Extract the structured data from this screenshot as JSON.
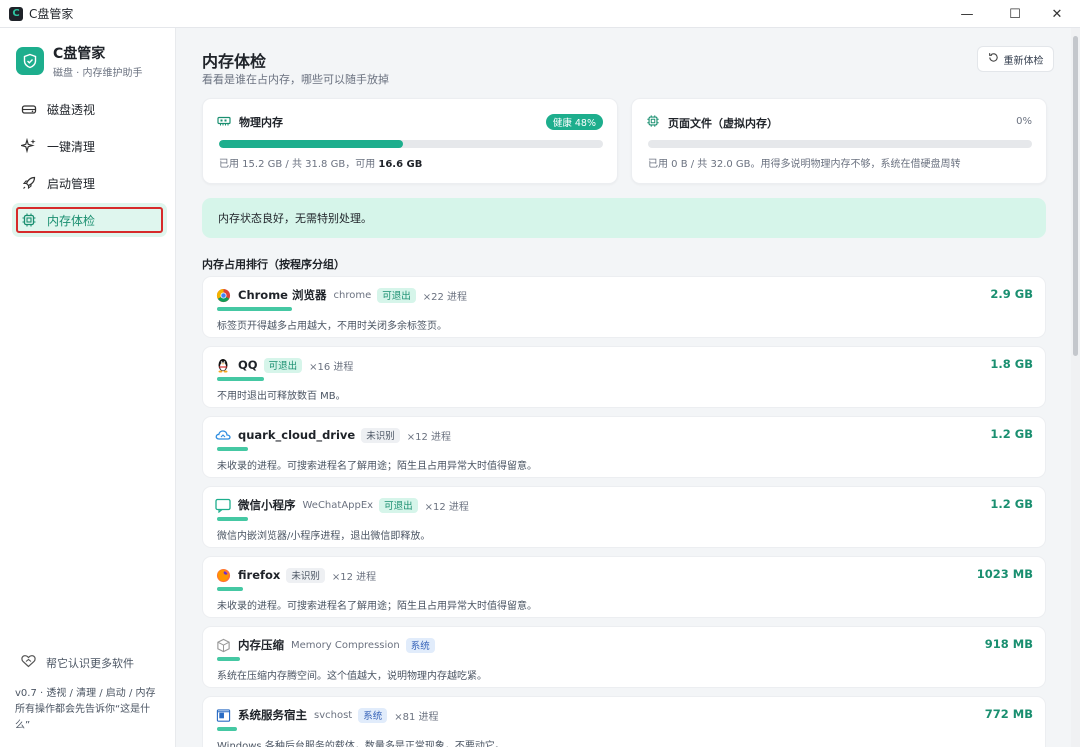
{
  "window": {
    "title": "C盘管家",
    "minimize": "—",
    "maximize": "☐",
    "close": "✕"
  },
  "sidebar": {
    "brand_name": "C盘管家",
    "brand_sub": "磁盘 · 内存维护助手",
    "items": [
      {
        "label": "磁盘透视",
        "icon": "disk-icon"
      },
      {
        "label": "一键清理",
        "icon": "sparkle-icon"
      },
      {
        "label": "启动管理",
        "icon": "rocket-icon"
      },
      {
        "label": "内存体检",
        "icon": "chip-icon",
        "active": true
      }
    ],
    "help_link": "帮它认识更多软件",
    "footer_note": "v0.7 · 透视 / 清理 / 启动 / 内存 所有操作都会先告诉你“这是什么”"
  },
  "main": {
    "title": "内存体检",
    "subtitle": "看看是谁在占内存，哪些可以随手放掉",
    "recheck_label": "重新体检",
    "physical": {
      "title": "物理内存",
      "badge": "健康 48%",
      "percent": 48,
      "info_prefix": "已用 15.2 GB / 共 31.8 GB，可用 ",
      "info_available": "16.6 GB"
    },
    "pagefile": {
      "title": "页面文件（虚拟内存）",
      "percent_label": "0%",
      "percent": 0,
      "info": "已用 0 B / 共 32.0 GB。用得多说明物理内存不够，系统在借硬盘周转"
    },
    "status_banner": "内存状态良好，无需特别处理。",
    "ranking_title": "内存占用排行（按程序分组）",
    "processes": [
      {
        "name": "Chrome 浏览器",
        "exe": "chrome",
        "tag": "可退出",
        "tag_type": "green",
        "count": "×22 进程",
        "size": "2.9 GB",
        "fraction": 1.0,
        "desc": "标签页开得越多占用越大，不用时关闭多余标签页。",
        "icon": "chrome-icon"
      },
      {
        "name": "QQ",
        "exe": "",
        "tag": "可退出",
        "tag_type": "green",
        "count": "×16 进程",
        "size": "1.8 GB",
        "fraction": 0.62,
        "desc": "不用时退出可释放数百 MB。",
        "icon": "penguin-icon"
      },
      {
        "name": "quark_cloud_drive",
        "exe": "",
        "tag": "未识别",
        "tag_type": "gray",
        "count": "×12 进程",
        "size": "1.2 GB",
        "fraction": 0.41,
        "desc": "未收录的进程。可搜索进程名了解用途；陌生且占用异常大时值得留意。",
        "icon": "cloud-icon"
      },
      {
        "name": "微信小程序",
        "exe": "WeChatAppEx",
        "tag": "可退出",
        "tag_type": "green",
        "count": "×12 进程",
        "size": "1.2 GB",
        "fraction": 0.41,
        "desc": "微信内嵌浏览器/小程序进程，退出微信即释放。",
        "icon": "chat-icon"
      },
      {
        "name": "firefox",
        "exe": "",
        "tag": "未识别",
        "tag_type": "gray",
        "count": "×12 进程",
        "size": "1023 MB",
        "fraction": 0.34,
        "desc": "未收录的进程。可搜索进程名了解用途；陌生且占用异常大时值得留意。",
        "icon": "firefox-icon"
      },
      {
        "name": "内存压缩",
        "exe": "Memory Compression",
        "tag": "系统",
        "tag_type": "blue",
        "count": "",
        "size": "918 MB",
        "fraction": 0.31,
        "desc": "系统在压缩内存腾空间。这个值越大，说明物理内存越吃紧。",
        "icon": "cube-icon"
      },
      {
        "name": "系统服务宿主",
        "exe": "svchost",
        "tag": "系统",
        "tag_type": "blue",
        "count": "×81 进程",
        "size": "772 MB",
        "fraction": 0.26,
        "desc": "Windows 各种后台服务的载体，数量多是正常现象，不要动它。",
        "icon": "window-icon"
      }
    ]
  }
}
